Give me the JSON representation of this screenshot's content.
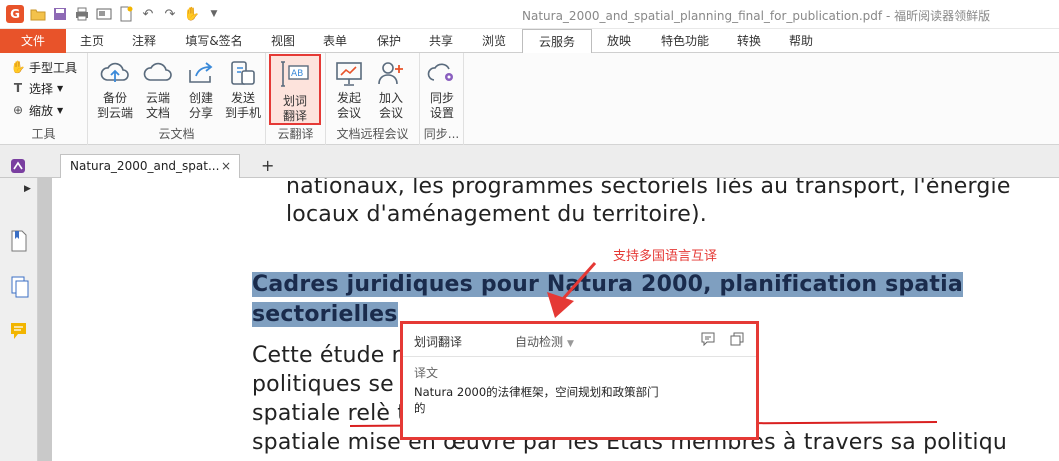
{
  "window": {
    "title": "Natura_2000_and_spatial_planning_final_for_publication.pdf - 福昕阅读器领鲜版",
    "logo_letter": "G"
  },
  "menu": {
    "tabs": [
      "文件",
      "主页",
      "注释",
      "填写&签名",
      "视图",
      "表单",
      "保护",
      "共享",
      "浏览",
      "云服务",
      "放映",
      "特色功能",
      "转换",
      "帮助"
    ],
    "active": "云服务"
  },
  "ribbon": {
    "tools_group": {
      "items": [
        "手型工具",
        "选择",
        "缩放"
      ],
      "label": "工具"
    },
    "cloud_docs_group": {
      "buttons": [
        "备份\n到云端",
        "云端\n文档",
        "创建\n分享",
        "发送\n到手机"
      ],
      "label": "云文档"
    },
    "translate_group": {
      "buttons": [
        "划词\n翻译"
      ],
      "label": "云翻译"
    },
    "meeting_group": {
      "buttons": [
        "发起\n会议",
        "加入\n会议"
      ],
      "label": "文档远程会议"
    },
    "sync_group": {
      "buttons": [
        "同步\n设置"
      ],
      "label": "同步..."
    }
  },
  "doc_tab": {
    "label": "Natura_2000_and_spat...",
    "close": "×",
    "new_tab": "+"
  },
  "document": {
    "lines": [
      "nationaux, les programmes sectoriels liés au transport, l'énergie",
      "locaux d'aménagement du territoire)."
    ],
    "heading_line1": "Cadres   juridiques   pour   Natura 2000,   planification   spatia",
    "heading_line2": "sectorielles",
    "body_line1": "Cette  étude                                   ntielle  entre  la  planifica",
    "body_line2": "politiques  se                                  à  Natura 2000.  Même",
    "body_line3": "spatiale  relè                                  ts  membres,  l'UE  influer",
    "body_line4": "spatiale  mise  en  œuvre  par  les  États  membres  à  travers  sa  politiqu"
  },
  "annotation": {
    "text": "支持多国语言互译"
  },
  "popup": {
    "title": "划词翻译",
    "language": "自动检测",
    "section_label": "译文",
    "translation": "Natura 2000的法律框架，空间规划和政策部门的"
  },
  "colors": {
    "accent": "#e8532a",
    "highlight_red": "#e53935",
    "selection": "#7f9fc0"
  }
}
